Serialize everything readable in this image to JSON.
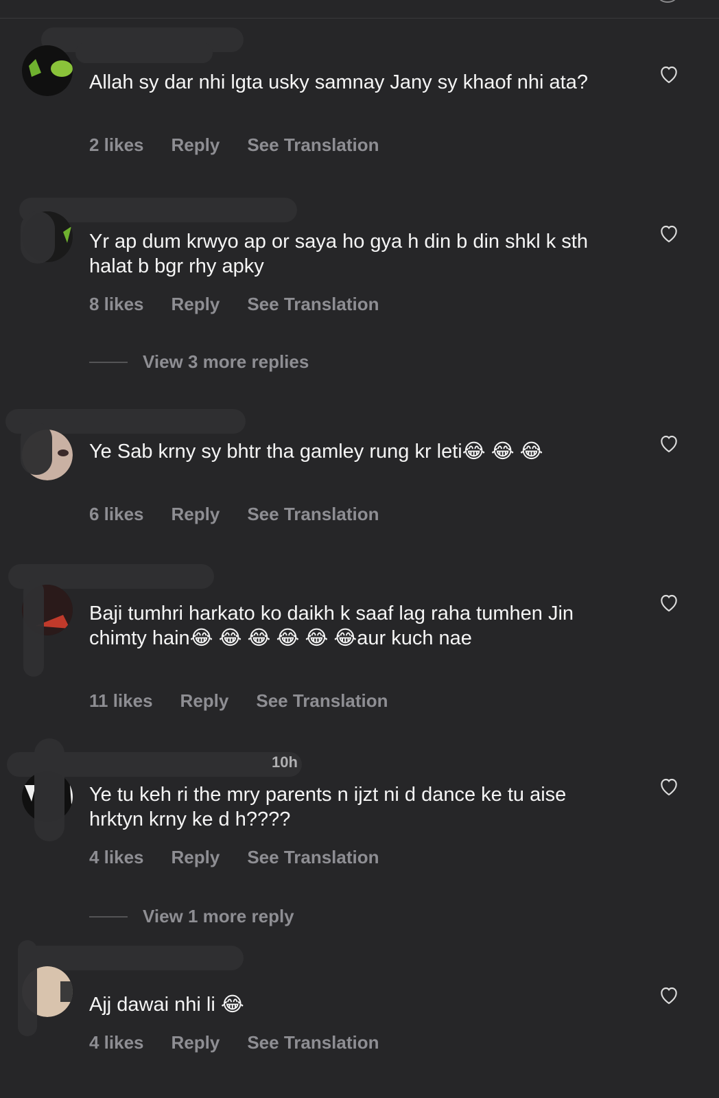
{
  "comments": [
    {
      "text": "Allah sy dar nhi lgta usky samnay Jany sy khaof nhi ata?",
      "likes": "2 likes",
      "reply": "Reply",
      "translate": "See Translation"
    },
    {
      "text": "Yr ap dum krwyo ap or saya ho gya h din b din shkl k sth halat b bgr rhy apky",
      "likes": "8 likes",
      "reply": "Reply",
      "translate": "See Translation",
      "view_replies": "View 3 more replies"
    },
    {
      "text": "Ye Sab krny sy bhtr tha gamley rung kr leti😂 😂 😂",
      "likes": "6 likes",
      "reply": "Reply",
      "translate": "See Translation"
    },
    {
      "text": "Baji tumhri harkato ko daikh k saaf lag raha tumhen Jin chimty hain😂 😂 😂 😂 😂 😂aur kuch nae",
      "likes": "11 likes",
      "reply": "Reply",
      "translate": "See Translation"
    },
    {
      "text": "Ye tu keh ri the mry parents n ijzt ni d dance ke tu aise hrktyn krny ke d h????",
      "likes": "4 likes",
      "reply": "Reply",
      "translate": "See Translation",
      "timestamp": "10h",
      "view_replies": "View 1 more reply"
    },
    {
      "text": "Ajj dawai nhi li 😂",
      "likes": "4 likes",
      "reply": "Reply",
      "translate": "See Translation"
    }
  ],
  "icons": {
    "like": "heart-icon"
  },
  "colors": {
    "background": "#262628",
    "text": "#f5f5f5",
    "meta": "#8e8e93"
  }
}
